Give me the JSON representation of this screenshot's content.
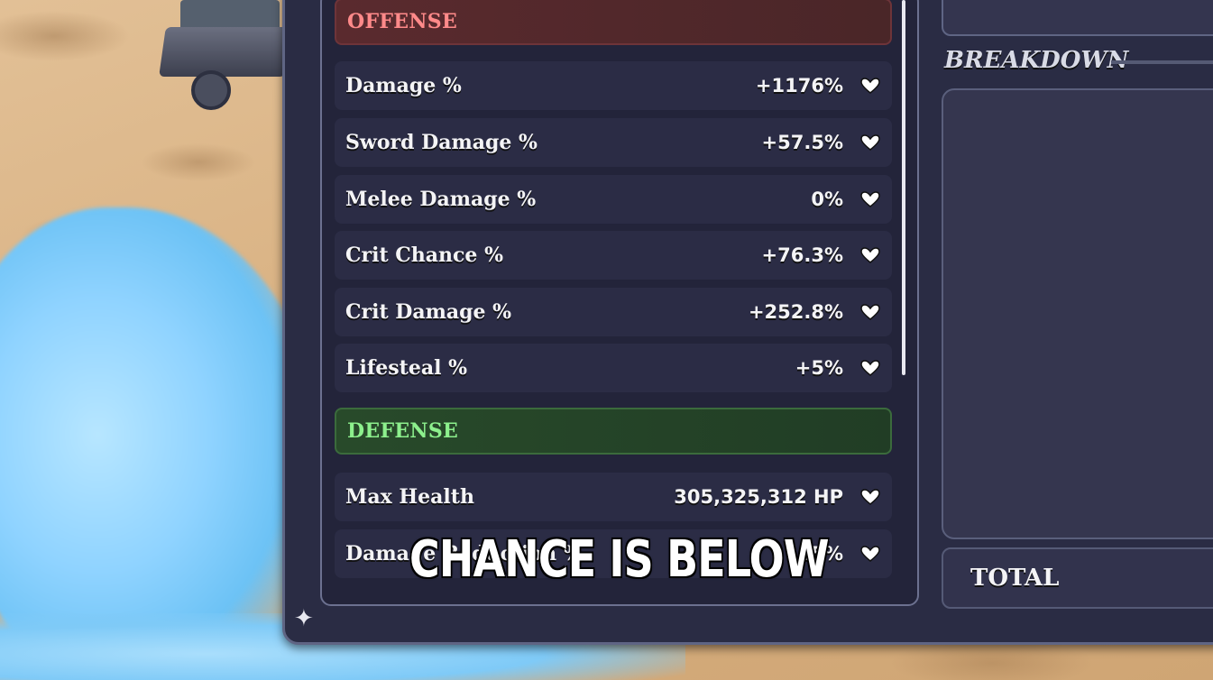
{
  "sections": {
    "offense": {
      "title": "OFFENSE",
      "stats": [
        {
          "label": "Damage %",
          "value": "+1176%"
        },
        {
          "label": "Sword Damage %",
          "value": "+57.5%"
        },
        {
          "label": "Melee Damage %",
          "value": "0%"
        },
        {
          "label": "Crit Chance %",
          "value": "+76.3%"
        },
        {
          "label": "Crit Damage %",
          "value": "+252.8%"
        },
        {
          "label": "Lifesteal %",
          "value": "+5%"
        }
      ]
    },
    "defense": {
      "title": "DEFENSE",
      "stats": [
        {
          "label": "Max Health",
          "value": "305,325,312 HP"
        },
        {
          "label": "Damage Reduction %",
          "value": ".5%"
        }
      ]
    }
  },
  "breakdown": {
    "title": "BREAKDOWN",
    "total_label": "TOTAL"
  },
  "subtitle": "CHANCE IS BELOW",
  "icons": {
    "expand": "heart-chevron-icon",
    "corner": "star-icon"
  }
}
